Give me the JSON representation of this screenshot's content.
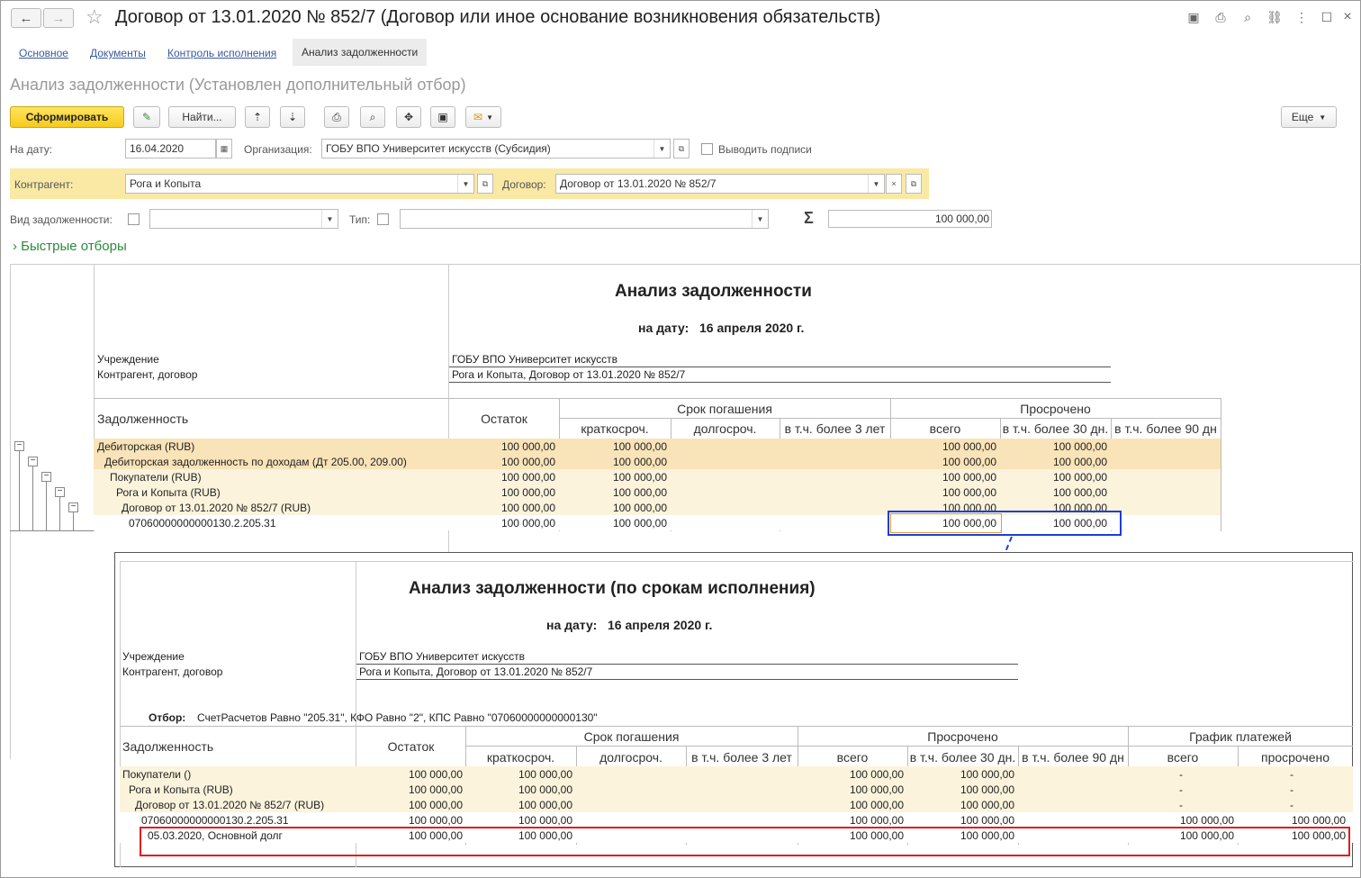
{
  "window": {
    "title": "Договор от 13.01.2020 № 852/7 (Договор или иное основание возникновения обязательств)"
  },
  "tabs": [
    "Основное",
    "Документы",
    "Контроль исполнения",
    "Анализ задолженности"
  ],
  "page_title": "Анализ задолженности (Установлен дополнительный отбор)",
  "toolbar": {
    "generate": "Сформировать",
    "find": "Найти...",
    "more": "Еще"
  },
  "filters": {
    "date_label": "На дату:",
    "date": "16.04.2020",
    "org_label": "Организация:",
    "org": "ГОБУ ВПО Университет искусств (Субсидия)",
    "signatures": "Выводить подписи",
    "contractor_label": "Контрагент:",
    "contractor": "Рога и Копыта",
    "contract_label": "Договор:",
    "contract": "Договор от 13.01.2020 № 852/7",
    "debt_type_label": "Вид задолженности:",
    "type_label": "Тип:",
    "sigma": "Σ",
    "sum": "100 000,00",
    "quick": "Быстрые отборы"
  },
  "report1": {
    "title": "Анализ задолженности",
    "date_label": "на дату:",
    "date": "16 апреля 2020 г.",
    "inst_label": "Учреждение",
    "inst": "ГОБУ ВПО Университет искусств",
    "contr_label": "Контрагент, договор",
    "contr": "Рога и Копыта, Договор от 13.01.2020 № 852/7",
    "col_debt": "Задолженность",
    "col_balance": "Остаток",
    "grp_term": "Срок погашения",
    "grp_overdue": "Просрочено",
    "sub": [
      "краткосроч.",
      "долгосроч.",
      "в т.ч. более 3 лет",
      "всего",
      "в т.ч. более 30 дн.",
      "в т.ч. более 90 дн"
    ],
    "rows": [
      {
        "name": "Дебиторская (RUB)",
        "v": [
          "100 000,00",
          "100 000,00",
          "",
          "",
          "100 000,00",
          "100 000,00",
          ""
        ]
      },
      {
        "name": "Дебиторская задолженность по доходам (Дт 205.00, 209.00)",
        "v": [
          "100 000,00",
          "100 000,00",
          "",
          "",
          "100 000,00",
          "100 000,00",
          ""
        ]
      },
      {
        "name": "Покупатели (RUB)",
        "v": [
          "100 000,00",
          "100 000,00",
          "",
          "",
          "100 000,00",
          "100 000,00",
          ""
        ]
      },
      {
        "name": "Рога и Копыта (RUB)",
        "v": [
          "100 000,00",
          "100 000,00",
          "",
          "",
          "100 000,00",
          "100 000,00",
          ""
        ]
      },
      {
        "name": "Договор от 13.01.2020 № 852/7 (RUB)",
        "v": [
          "100 000,00",
          "100 000,00",
          "",
          "",
          "100 000,00",
          "100 000,00",
          ""
        ]
      },
      {
        "name": "07060000000000130.2.205.31",
        "v": [
          "100 000,00",
          "100 000,00",
          "",
          "",
          "100 000,00",
          "100 000,00",
          ""
        ]
      }
    ]
  },
  "report2": {
    "title": "Анализ задолженности (по срокам исполнения)",
    "date_label": "на дату:",
    "date": "16 апреля 2020 г.",
    "inst_label": "Учреждение",
    "inst": "ГОБУ ВПО Университет искусств",
    "contr_label": "Контрагент, договор",
    "contr": "Рога и Копыта, Договор от 13.01.2020 № 852/7",
    "filter_label": "Отбор:",
    "filter": "СчетРасчетов Равно \"205.31\", КФО Равно \"2\", КПС Равно \"07060000000000130\"",
    "col_debt": "Задолженность",
    "col_balance": "Остаток",
    "grp_term": "Срок погашения",
    "grp_overdue": "Просрочено",
    "grp_sched": "График платежей",
    "sub": [
      "краткосроч.",
      "долгосроч.",
      "в т.ч. более 3 лет",
      "всего",
      "в т.ч. более 30 дн.",
      "в т.ч. более 90 дн",
      "всего",
      "просрочено"
    ],
    "rows": [
      {
        "name": "Покупатели ()",
        "v": [
          "100 000,00",
          "100 000,00",
          "",
          "",
          "100 000,00",
          "100 000,00",
          "",
          "-",
          "-"
        ]
      },
      {
        "name": "Рога и Копыта (RUB)",
        "v": [
          "100 000,00",
          "100 000,00",
          "",
          "",
          "100 000,00",
          "100 000,00",
          "",
          "-",
          "-"
        ]
      },
      {
        "name": "Договор от 13.01.2020 № 852/7 (RUB)",
        "v": [
          "100 000,00",
          "100 000,00",
          "",
          "",
          "100 000,00",
          "100 000,00",
          "",
          "-",
          "-"
        ]
      },
      {
        "name": "07060000000000130.2.205.31",
        "v": [
          "100 000,00",
          "100 000,00",
          "",
          "",
          "100 000,00",
          "100 000,00",
          "",
          "100 000,00",
          "100 000,00"
        ]
      },
      {
        "name": "05.03.2020, Основной долг",
        "v": [
          "100 000,00",
          "100 000,00",
          "",
          "",
          "100 000,00",
          "100 000,00",
          "",
          "100 000,00",
          "100 000,00"
        ]
      }
    ]
  },
  "colors": {
    "accent_yellow": "#f7cb1c",
    "highlight_row": "#f9e3b8",
    "light_row": "#fbf3dc",
    "blue_box": "#1c3fd6",
    "red_box": "#e21b1b"
  }
}
